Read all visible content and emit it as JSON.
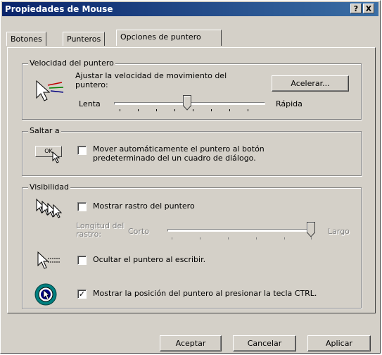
{
  "window": {
    "title": "Propiedades de Mouse",
    "help_btn": "?",
    "close_btn": "X"
  },
  "tabs": [
    {
      "label": "Botones"
    },
    {
      "label": "Punteros"
    },
    {
      "label": "Opciones de puntero"
    }
  ],
  "speed": {
    "legend": "Velocidad del puntero",
    "description": "Ajustar la velocidad de movimiento del puntero:",
    "slow": "Lenta",
    "fast": "Rápida",
    "accel_button": "Acelerar..."
  },
  "snap": {
    "legend": "Saltar a",
    "checkbox_label": "Mover automáticamente el puntero al botón predeterminado del un cuadro de diálogo.",
    "ok_icon_text": "OK",
    "checked": false
  },
  "visibility": {
    "legend": "Visibilidad",
    "trails_label": "Mostrar rastro del puntero",
    "trails_checked": false,
    "trail_length_label": "Longitud del rastro:",
    "short": "Corto",
    "long": "Largo",
    "hide_label": "Ocultar el puntero al escribir.",
    "hide_checked": false,
    "ctrl_label": "Mostrar la posición del puntero al presionar la tecla CTRL.",
    "ctrl_checked": true
  },
  "footer": {
    "ok": "Aceptar",
    "cancel": "Cancelar",
    "apply": "Aplicar"
  },
  "colors": {
    "titlebar_start": "#0a246a",
    "titlebar_end": "#3a6ea5",
    "face": "#d4d0c8"
  }
}
